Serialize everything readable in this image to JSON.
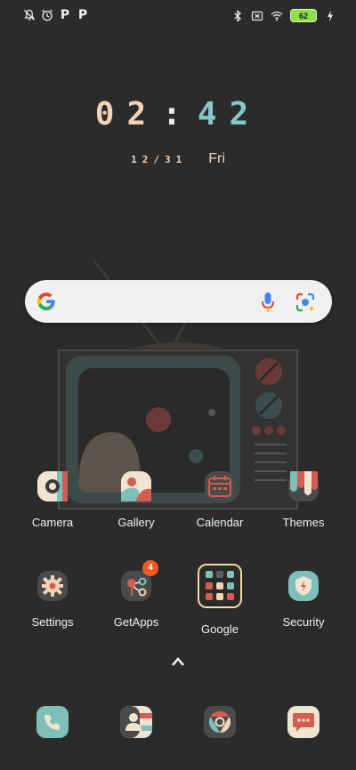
{
  "status_bar": {
    "left_icons": [
      "notifications-off-icon",
      "alarm-icon",
      "p-app-icon",
      "p-app-icon"
    ],
    "p_glyphs": [
      "P",
      "P"
    ],
    "right_icons": [
      "bluetooth-icon",
      "sim-off-icon",
      "wifi-icon"
    ],
    "battery_level": "62"
  },
  "clock": {
    "hours": "02",
    "separator": ":",
    "minutes": "42",
    "date": "12/31",
    "weekday": "Fri"
  },
  "search_bar": {
    "icons": [
      "google-logo-icon",
      "microphone-icon",
      "google-lens-icon"
    ]
  },
  "apps_row1": [
    {
      "label": "Camera",
      "icon": "camera-icon"
    },
    {
      "label": "Gallery",
      "icon": "gallery-icon"
    },
    {
      "label": "Calendar",
      "icon": "calendar-icon"
    },
    {
      "label": "Themes",
      "icon": "themes-icon"
    }
  ],
  "apps_row2": [
    {
      "label": "Settings",
      "icon": "settings-gear-icon"
    },
    {
      "label": "GetApps",
      "icon": "getapps-icon",
      "badge": "4"
    },
    {
      "label": "Google",
      "icon": "google-folder-icon"
    },
    {
      "label": "Security",
      "icon": "security-shield-icon"
    }
  ],
  "dock": [
    {
      "icon": "phone-icon"
    },
    {
      "icon": "contacts-icon"
    },
    {
      "icon": "chrome-icon"
    },
    {
      "icon": "messages-icon"
    }
  ],
  "colors": {
    "background": "#2b2b2b",
    "clock_hours": "#f3d2b6",
    "clock_minutes": "#86c8c6",
    "badge": "#ee5a24",
    "battery": "#8ee04a"
  }
}
